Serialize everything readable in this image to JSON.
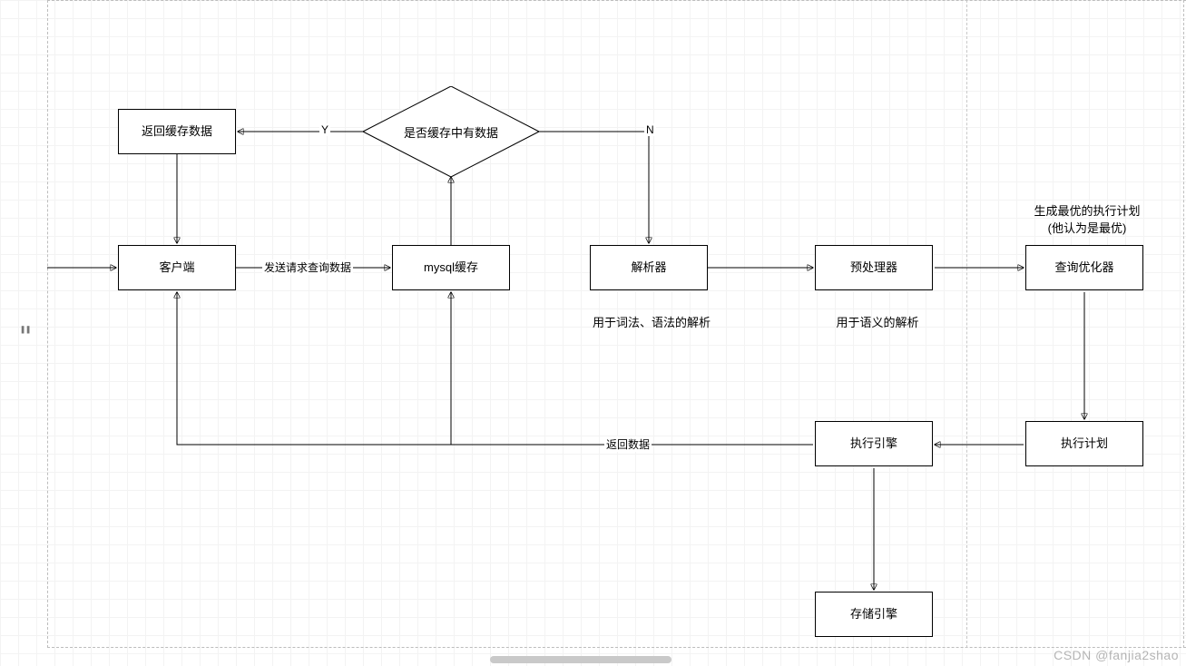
{
  "nodes": {
    "return_cache": "返回缓存数据",
    "client": "客户端",
    "mysql_cache": "mysql缓存",
    "cache_decision": "是否缓存中有数据",
    "parser": "解析器",
    "preprocessor": "预处理器",
    "optimizer": "查询优化器",
    "exec_plan": "执行计划",
    "exec_engine": "执行引擎",
    "storage_engine": "存储引擎"
  },
  "edges": {
    "send_query": "发送请求查询数据",
    "yes": "Y",
    "no": "N",
    "return_data": "返回数据"
  },
  "annotations": {
    "parser_note": "用于词法、语法的解析",
    "preprocessor_note": "用于语义的解析",
    "optimizer_note_line1": "生成最优的执行计划",
    "optimizer_note_line2": "(他认为是最优)"
  },
  "watermark": "CSDN @fanjia2shao"
}
